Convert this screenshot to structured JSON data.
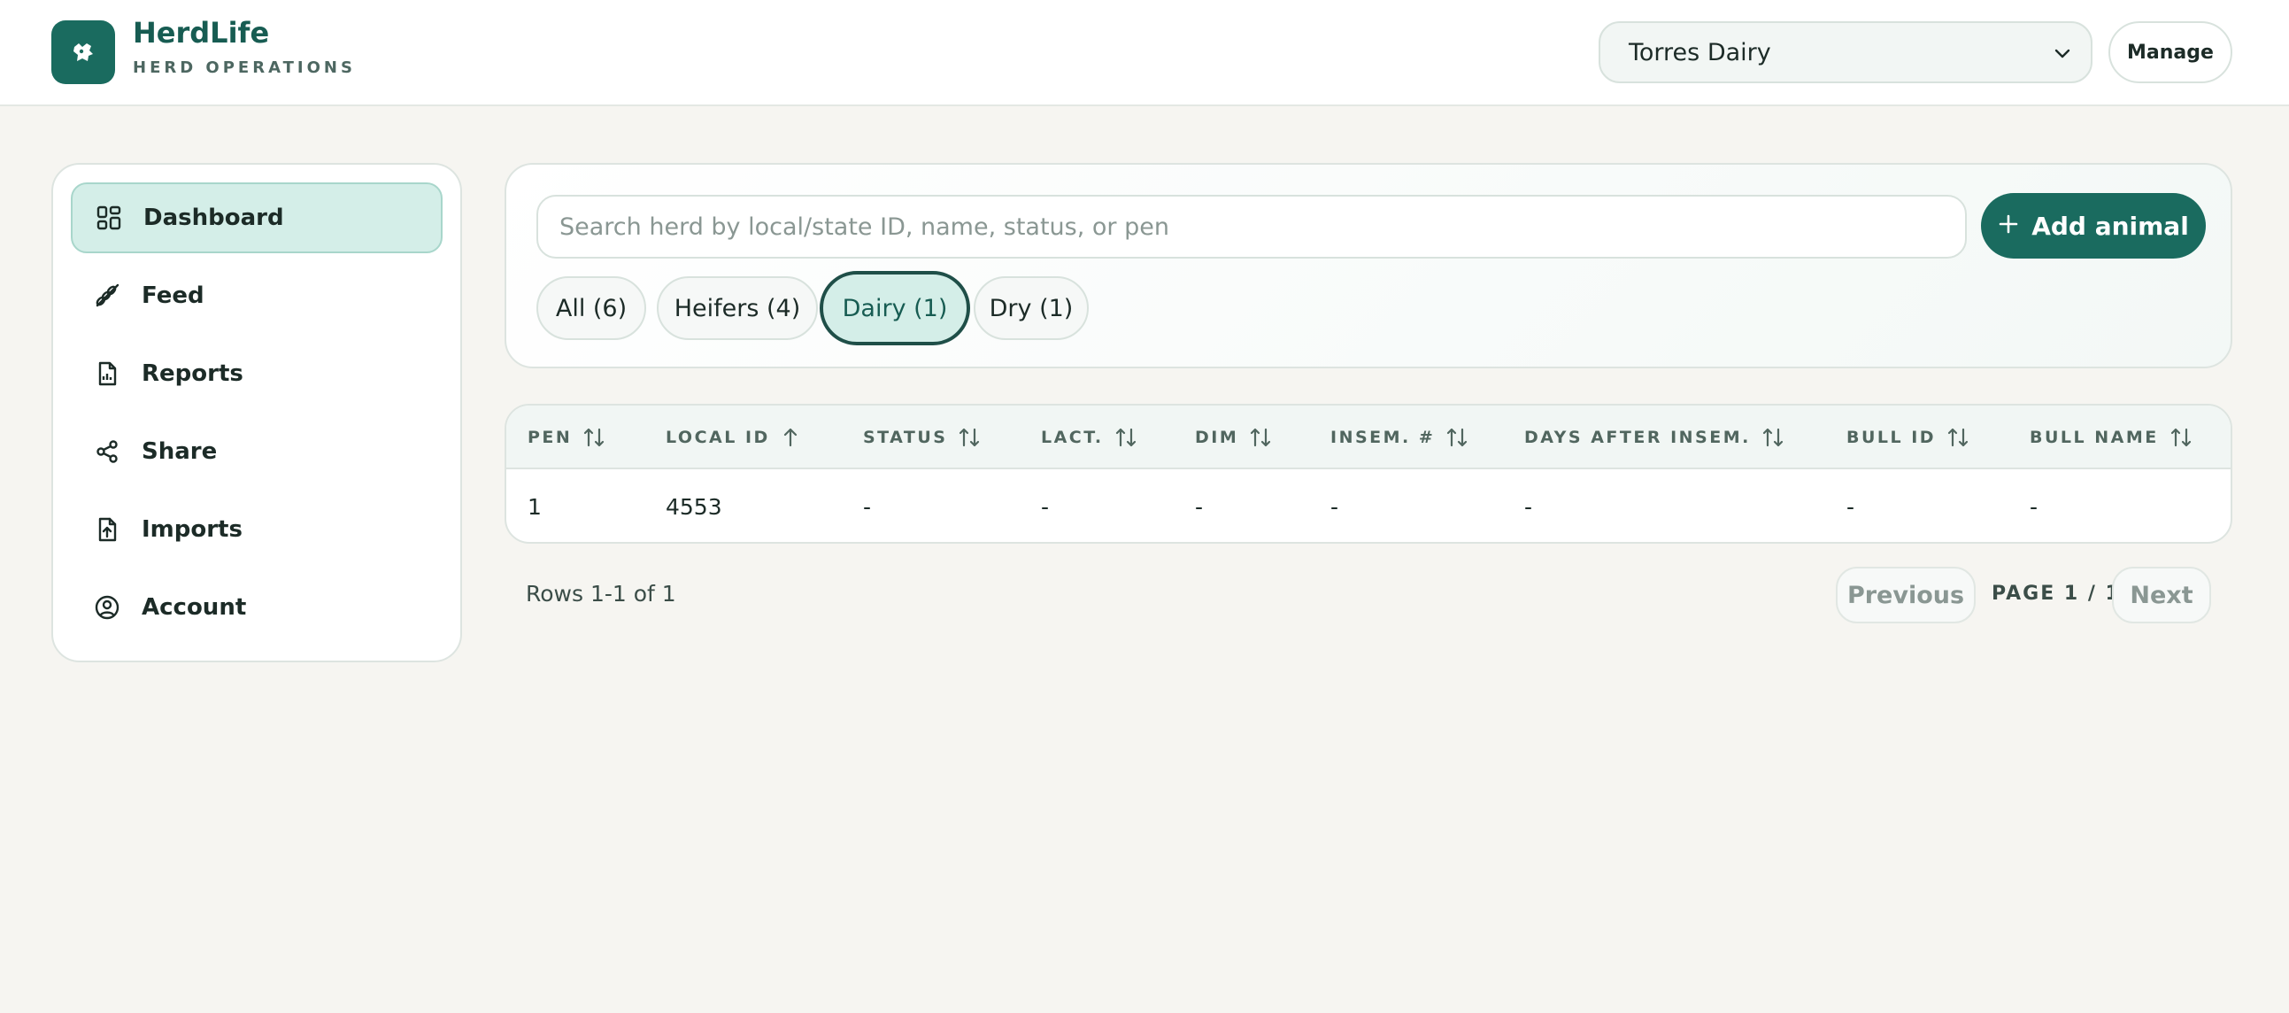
{
  "header": {
    "brand_name": "HerdLife",
    "brand_subtitle": "HERD OPERATIONS",
    "herd_select_value": "Torres Dairy",
    "manage_label": "Manage"
  },
  "sidebar": {
    "items": [
      {
        "label": "Dashboard",
        "icon": "dashboard-grid-icon",
        "active": true
      },
      {
        "label": "Feed",
        "icon": "wheat-icon"
      },
      {
        "label": "Reports",
        "icon": "report-file-icon"
      },
      {
        "label": "Share",
        "icon": "share-icon"
      },
      {
        "label": "Imports",
        "icon": "upload-file-icon"
      },
      {
        "label": "Account",
        "icon": "user-circle-icon"
      }
    ]
  },
  "search": {
    "placeholder": "Search herd by local/state ID, name, status, or pen",
    "value": "",
    "add_label": "Add animal"
  },
  "filters": [
    {
      "label": "All (6)"
    },
    {
      "label": "Heifers (4)"
    },
    {
      "label": "Dairy (1)",
      "active": true
    },
    {
      "label": "Dry (1)"
    }
  ],
  "table": {
    "columns": [
      {
        "label": "PEN",
        "sort": "none"
      },
      {
        "label": "LOCAL ID",
        "sort": "asc"
      },
      {
        "label": "STATUS",
        "sort": "none"
      },
      {
        "label": "LACT.",
        "sort": "none"
      },
      {
        "label": "DIM",
        "sort": "none"
      },
      {
        "label": "INSEM. #",
        "sort": "none"
      },
      {
        "label": "DAYS AFTER INSEM.",
        "sort": "none"
      },
      {
        "label": "BULL ID",
        "sort": "none"
      },
      {
        "label": "BULL NAME",
        "sort": "none"
      }
    ],
    "rows": [
      [
        "1",
        "4553",
        "-",
        "-",
        "-",
        "-",
        "-",
        "-",
        "-"
      ]
    ]
  },
  "pagination": {
    "rows_info": "Rows 1-1 of 1",
    "previous_label": "Previous",
    "page_label": "PAGE 1 / 1",
    "next_label": "Next"
  },
  "colors": {
    "brand": "#1a6b5f",
    "active_bg": "#d4eee8",
    "page_bg": "#f6f5f1"
  }
}
